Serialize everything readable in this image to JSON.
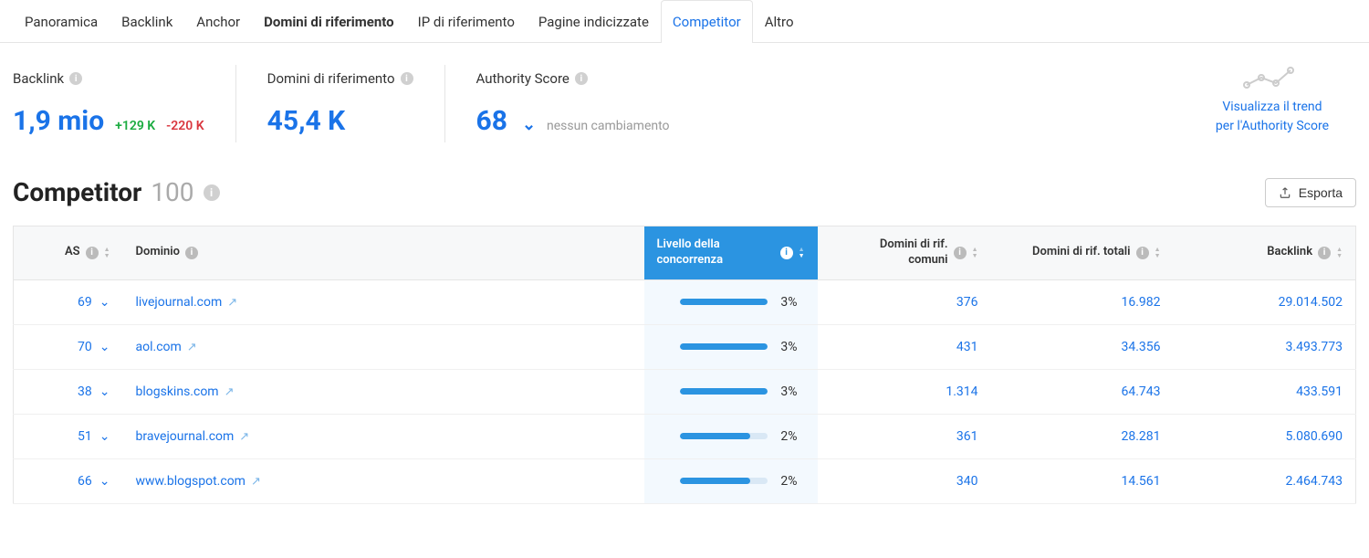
{
  "tabs": [
    {
      "label": "Panoramica",
      "active": false,
      "bold": false
    },
    {
      "label": "Backlink",
      "active": false,
      "bold": false
    },
    {
      "label": "Anchor",
      "active": false,
      "bold": false
    },
    {
      "label": "Domini di riferimento",
      "active": false,
      "bold": true
    },
    {
      "label": "IP di riferimento",
      "active": false,
      "bold": false
    },
    {
      "label": "Pagine indicizzate",
      "active": false,
      "bold": false
    },
    {
      "label": "Competitor",
      "active": true,
      "bold": false
    },
    {
      "label": "Altro",
      "active": false,
      "bold": false
    }
  ],
  "metrics": {
    "backlinks": {
      "label": "Backlink",
      "value": "1,9 mio",
      "delta_up": "+129 K",
      "delta_down": "-220 K"
    },
    "refdomains": {
      "label": "Domini di riferimento",
      "value": "45,4 K"
    },
    "authority": {
      "label": "Authority Score",
      "value": "68",
      "sub": "nessun cambiamento"
    }
  },
  "trend": {
    "line1": "Visualizza il trend",
    "line2": "per l'Authority Score"
  },
  "section": {
    "title": "Competitor",
    "count": "100"
  },
  "export_label": "Esporta",
  "columns": {
    "as": "AS",
    "domain": "Dominio",
    "competition": "Livello della concorrenza",
    "common": "Domini di rif. comuni",
    "total": "Domini di rif. totali",
    "backlinks": "Backlink"
  },
  "rows": [
    {
      "as": "69",
      "domain": "livejournal.com",
      "comp_pct": "3%",
      "comp_bar": 100,
      "common": "376",
      "total": "16.982",
      "backlinks": "29.014.502"
    },
    {
      "as": "70",
      "domain": "aol.com",
      "comp_pct": "3%",
      "comp_bar": 100,
      "common": "431",
      "total": "34.356",
      "backlinks": "3.493.773"
    },
    {
      "as": "38",
      "domain": "blogskins.com",
      "comp_pct": "3%",
      "comp_bar": 100,
      "common": "1.314",
      "total": "64.743",
      "backlinks": "433.591"
    },
    {
      "as": "51",
      "domain": "bravejournal.com",
      "comp_pct": "2%",
      "comp_bar": 80,
      "common": "361",
      "total": "28.281",
      "backlinks": "5.080.690"
    },
    {
      "as": "66",
      "domain": "www.blogspot.com",
      "comp_pct": "2%",
      "comp_bar": 80,
      "common": "340",
      "total": "14.561",
      "backlinks": "2.464.743"
    }
  ]
}
